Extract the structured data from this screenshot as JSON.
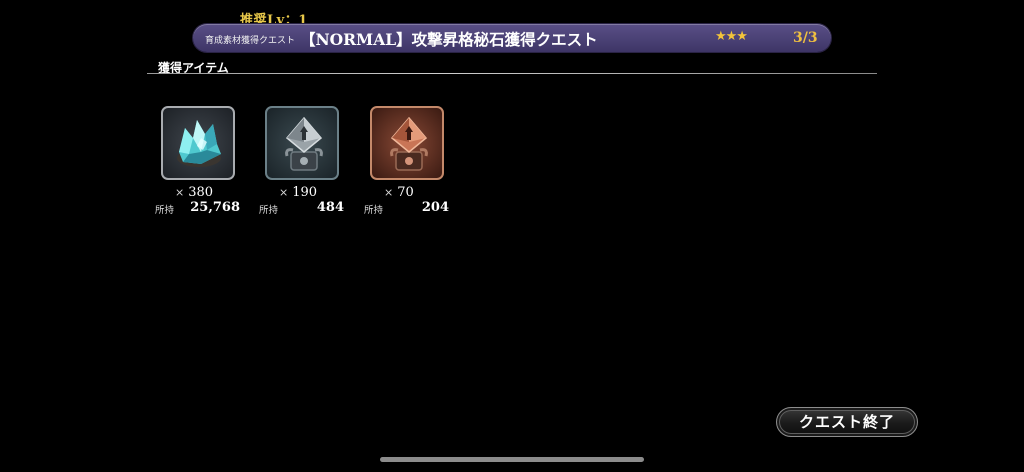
{
  "quest": {
    "recommended_level": "推奨Lv：1",
    "category": "育成素材獲得クエスト",
    "title": "【NORMAL】攻撃昇格秘石獲得クエスト",
    "stars": "★★★",
    "progress": "3/3"
  },
  "rewards": {
    "section_label": "獲得アイテム",
    "items": [
      {
        "icon": "blue-crystal-icon",
        "qty_prefix": "×",
        "quantity": "380",
        "owned_label": "所持",
        "owned": "25,768"
      },
      {
        "icon": "silver-promotion-stone-icon",
        "qty_prefix": "×",
        "quantity": "190",
        "owned_label": "所持",
        "owned": "484"
      },
      {
        "icon": "bronze-promotion-stone-icon",
        "qty_prefix": "×",
        "quantity": "70",
        "owned_label": "所持",
        "owned": "204"
      }
    ]
  },
  "actions": {
    "end_quest_label": "クエスト終了"
  },
  "colors": {
    "title_bar": "#4a4175",
    "gold": "#e8c84a",
    "background": "#000000"
  }
}
